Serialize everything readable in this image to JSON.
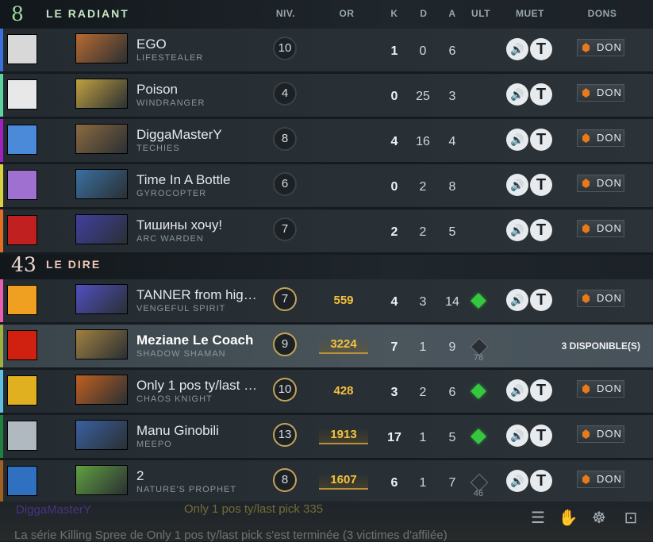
{
  "radiant": {
    "score": "8",
    "name": "LE RADIANT"
  },
  "dire": {
    "score": "43",
    "name": "LE DIRE"
  },
  "columns": {
    "level": "NIV.",
    "gold": "OR",
    "kills": "K",
    "deaths": "D",
    "assists": "A",
    "ult": "ULT",
    "mute": "MUET",
    "gifts": "DONS"
  },
  "players": [
    {
      "name": "EGO",
      "hero": "LIFESTEALER",
      "level": "10",
      "gold": "",
      "k": "1",
      "d": "0",
      "a": "6",
      "ult": "none",
      "ult_cd": "",
      "don": "DON",
      "stripe": "#3a6fdc"
    },
    {
      "name": "Poison",
      "hero": "WINDRANGER",
      "level": "4",
      "gold": "",
      "k": "0",
      "d": "25",
      "a": "3",
      "ult": "none",
      "ult_cd": "",
      "don": "DON",
      "stripe": "#5bd4a2"
    },
    {
      "name": "DiggaMasterY",
      "hero": "TECHIES",
      "level": "8",
      "gold": "",
      "k": "4",
      "d": "16",
      "a": "4",
      "ult": "none",
      "ult_cd": "",
      "don": "DON",
      "stripe": "#a020c0"
    },
    {
      "name": "Time In A Bottle",
      "hero": "GYROCOPTER",
      "level": "6",
      "gold": "",
      "k": "0",
      "d": "2",
      "a": "8",
      "ult": "none",
      "ult_cd": "",
      "don": "DON",
      "stripe": "#d8d040"
    },
    {
      "name": "Тишины хочу!",
      "hero": "ARC WARDEN",
      "level": "7",
      "gold": "",
      "k": "2",
      "d": "2",
      "a": "5",
      "ult": "none",
      "ult_cd": "",
      "don": "DON",
      "stripe": "#e07020"
    },
    {
      "name": "TANNER from hig…",
      "hero": "VENGEFUL SPIRIT",
      "level": "7",
      "gold": "559",
      "k": "4",
      "d": "3",
      "a": "14",
      "ult": "ready",
      "ult_cd": "",
      "don": "DON",
      "stripe": "#e860b0"
    },
    {
      "name": "Meziane Le Coach",
      "hero": "SHADOW SHAMAN",
      "level": "9",
      "gold": "3224",
      "k": "7",
      "d": "1",
      "a": "9",
      "ult": "cooldown",
      "ult_cd": "78",
      "don": "",
      "available": "3 DISPONIBLE(S)",
      "stripe": "#a0b040"
    },
    {
      "name": "Only 1 pos ty/last …",
      "hero": "CHAOS KNIGHT",
      "level": "10",
      "gold": "428",
      "k": "3",
      "d": "2",
      "a": "6",
      "ult": "ready",
      "ult_cd": "",
      "don": "DON",
      "stripe": "#60c0e0"
    },
    {
      "name": "Manu Ginobili",
      "hero": "MEEPO",
      "level": "13",
      "gold": "1913",
      "k": "17",
      "d": "1",
      "a": "5",
      "ult": "ready",
      "ult_cd": "",
      "don": "DON",
      "stripe": "#208040"
    },
    {
      "name": "2",
      "hero": "NATURE'S PROPHET",
      "level": "8",
      "gold": "1607",
      "k": "6",
      "d": "1",
      "a": "7",
      "ult": "cooldown",
      "ult_cd": "46",
      "don": "DON",
      "stripe": "#a06020"
    }
  ],
  "chat": {
    "line1_name": "DiggaMasterY",
    "line1_text": "Only 1 pos ty/last pick 335",
    "line2": "La série Killing Spree de      Only 1 pos ty/last pick s'est terminée (3 victimes d'affilée)"
  }
}
